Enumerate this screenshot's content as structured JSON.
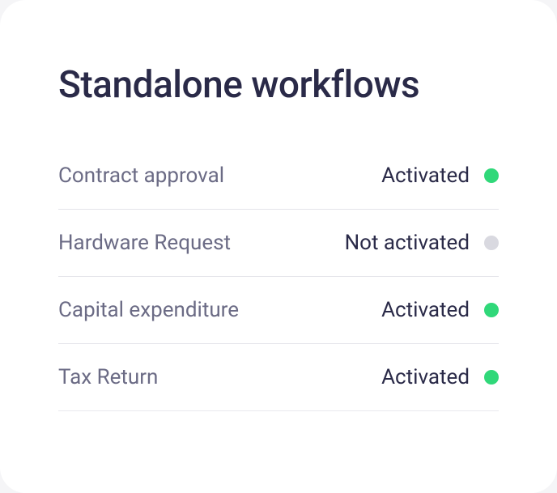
{
  "title": "Standalone workflows",
  "status_colors": {
    "active": "#30d879",
    "inactive": "#d9d9e0"
  },
  "workflows": [
    {
      "name": "Contract approval",
      "status": "Activated",
      "active": true
    },
    {
      "name": "Hardware Request",
      "status": "Not activated",
      "active": false
    },
    {
      "name": "Capital expenditure",
      "status": "Activated",
      "active": true
    },
    {
      "name": "Tax Return",
      "status": "Activated",
      "active": true
    }
  ]
}
